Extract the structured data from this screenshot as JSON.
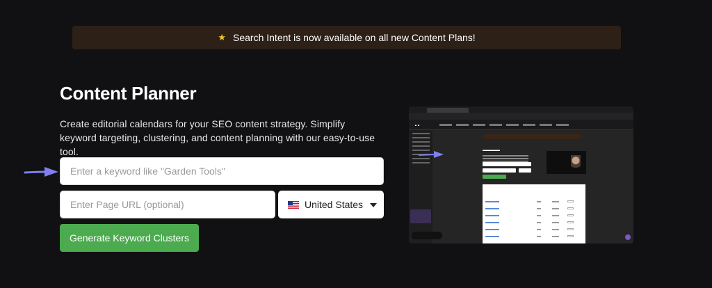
{
  "banner": {
    "icon": "sparkle-star-icon",
    "text": "Search Intent is now available on all new Content Plans!"
  },
  "page": {
    "title": "Content Planner",
    "description": "Create editorial calendars for your SEO content strategy. Simplify keyword targeting, clustering, and content planning with our easy-to-use tool."
  },
  "form": {
    "keyword_placeholder": "Enter a keyword like \"Garden Tools\"",
    "url_placeholder": "Enter Page URL (optional)",
    "country_value": "United States",
    "country_flag": "us-flag-icon",
    "submit_label": "Generate Keyword Clusters"
  },
  "colors": {
    "background": "#111012",
    "banner_bg": "#2d2017",
    "button": "#4caa4f",
    "arrow": "#7f7ff0"
  }
}
